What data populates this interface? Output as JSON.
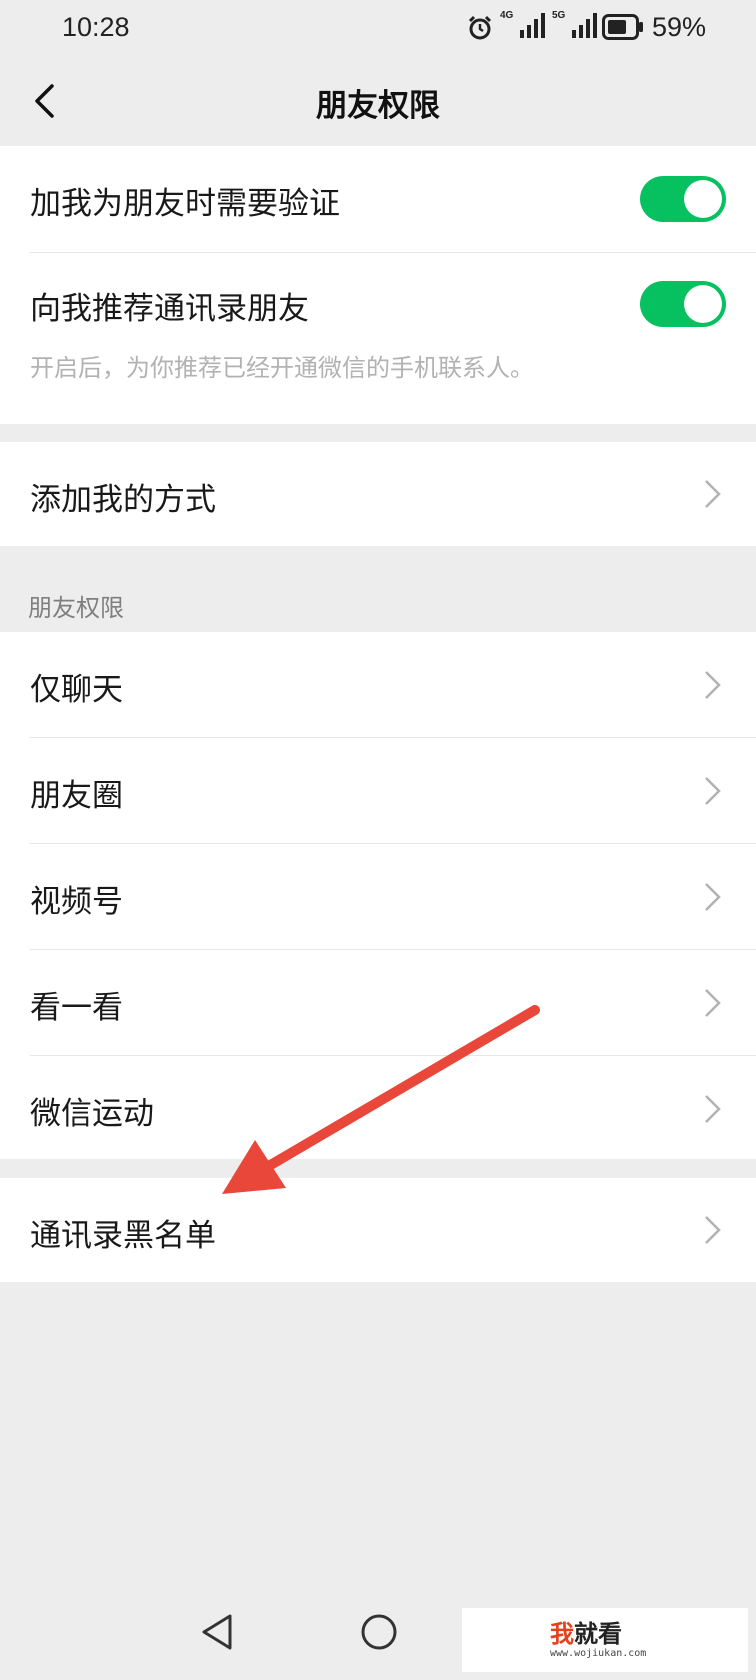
{
  "status_bar": {
    "time": "10:28",
    "net1": "4G",
    "net2": "5G",
    "battery_percent": "59%",
    "icons": [
      "alarm-icon",
      "signal-4g-icon",
      "signal-5g-icon",
      "battery-icon"
    ]
  },
  "header": {
    "title": "朋友权限",
    "back_icon": "chevron-left-icon"
  },
  "verify_group": {
    "items": [
      {
        "label": "加我为朋友时需要验证",
        "toggle_on": true
      },
      {
        "label": "向我推荐通讯录朋友",
        "toggle_on": true,
        "hint": "开启后，为你推荐已经开通微信的手机联系人。"
      }
    ]
  },
  "add_methods": {
    "label": "添加我的方式"
  },
  "permissions": {
    "section_title": "朋友权限",
    "items": [
      {
        "label": "仅聊天"
      },
      {
        "label": "朋友圈"
      },
      {
        "label": "视频号"
      },
      {
        "label": "看一看"
      },
      {
        "label": "微信运动"
      }
    ]
  },
  "blacklist": {
    "label": "通讯录黑名单"
  },
  "colors": {
    "accent": "#07c160",
    "annotation_arrow": "#e8473a",
    "background": "#ededed"
  },
  "system_nav": {
    "icons": [
      "nav-back-icon",
      "nav-home-icon"
    ]
  },
  "watermark": {
    "brand_accent": "我",
    "brand_rest": "就看",
    "url": "www.wojiukan.com"
  }
}
